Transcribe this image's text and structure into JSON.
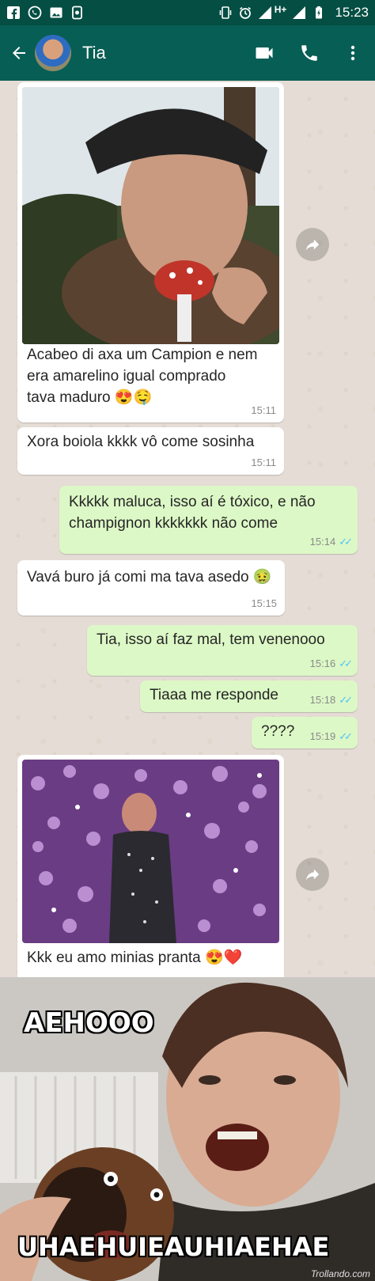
{
  "statusbar": {
    "time": "15:23",
    "network": "H+",
    "left_icons": [
      "facebook-icon",
      "whatsapp-icon",
      "gallery-icon",
      "app-icon"
    ],
    "right_icons": [
      "vibrate-icon",
      "alarm-icon",
      "signal-icon",
      "battery-icon"
    ]
  },
  "header": {
    "contact_name": "Tia",
    "icons": [
      "back-arrow-icon",
      "video-call-icon",
      "phone-call-icon",
      "more-vert-icon"
    ]
  },
  "messages": [
    {
      "direction": "in",
      "has_photo": true,
      "photo": "mushroom-photo",
      "text_lines": [
        "Acabeo di axa um Campion e nem",
        "era amarelino igual comprado",
        "tava maduro 😍🤤"
      ],
      "time": "15:11"
    },
    {
      "direction": "in",
      "text": "Xora boiola kkkk vô come sosinha",
      "time": "15:11"
    },
    {
      "direction": "out",
      "text_lines": [
        "Kkkkk maluca, isso aí é tóxico, e não",
        "champignon kkkkkkk não come"
      ],
      "time": "15:14",
      "read": true
    },
    {
      "direction": "in",
      "text": "Vavá buro já comi ma tava asedo 🤢",
      "time": "15:15"
    },
    {
      "direction": "out",
      "text": "Tia, isso aí faz mal, tem venenooo",
      "time": "15:16",
      "read": true
    },
    {
      "direction": "out",
      "text": "Tiaaa me responde",
      "time": "15:18",
      "read": true
    },
    {
      "direction": "out",
      "text": "????",
      "time": "15:19",
      "read": true
    },
    {
      "direction": "in",
      "has_photo": true,
      "photo": "flowers-photo",
      "text": "Kkk eu amo minias pranta 😍❤️"
    }
  ],
  "meme": {
    "top_text": "AEHOOO",
    "bottom_text": "UHAEHUIEAUHIAEHAE",
    "watermark": "Trollando.com"
  },
  "colors": {
    "statusbar": "#044e43",
    "appbar": "#075e54",
    "incoming_bubble": "#ffffff",
    "outgoing_bubble": "#dcf8c6",
    "read_ticks": "#4fc3f7",
    "chat_background": "#e5ddd5"
  }
}
